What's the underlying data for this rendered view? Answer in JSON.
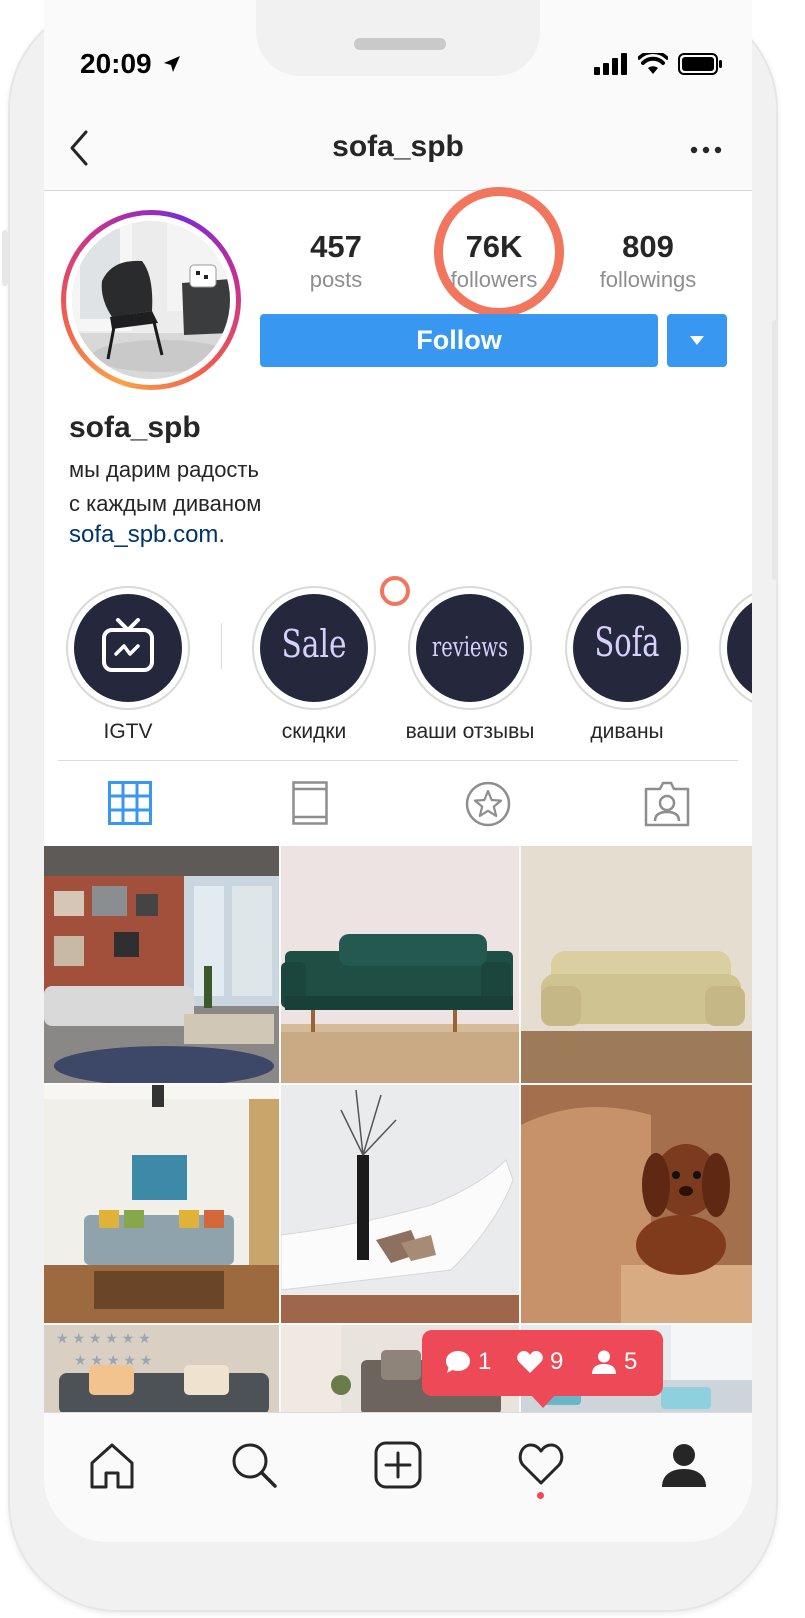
{
  "status_bar": {
    "time": "20:09"
  },
  "navbar": {
    "title": "sofa_spb"
  },
  "profile": {
    "stats": [
      {
        "value": "457",
        "label": "posts"
      },
      {
        "value": "76K",
        "label": "followers"
      },
      {
        "value": "809",
        "label": "followings"
      }
    ],
    "follow_label": "Follow",
    "username": "sofa_spb",
    "bio_line1": "мы дарим радость",
    "bio_line2": "с каждым диваном",
    "link": "sofa_spb.com."
  },
  "highlights": [
    {
      "label": "IGTV",
      "icon": "igtv-icon"
    },
    {
      "label": "скидки",
      "cover_text": "Sale"
    },
    {
      "label": "ваши отзывы",
      "cover_text": "reviews"
    },
    {
      "label": "диваны",
      "cover_text": "Sofa"
    }
  ],
  "profile_tabs": [
    "grid-icon",
    "feed-icon",
    "tagged-star-icon",
    "tagged-person-icon"
  ],
  "notification": {
    "comments": "1",
    "likes": "9",
    "follows": "5"
  },
  "bottom_nav": [
    "home-icon",
    "search-icon",
    "add-post-icon",
    "activity-heart-icon",
    "profile-icon"
  ],
  "colors": {
    "accent": "#3897f0",
    "annotation": "#f2765e",
    "notification": "#ed4956",
    "link": "#003569",
    "highlight_bg": "#25273d"
  }
}
